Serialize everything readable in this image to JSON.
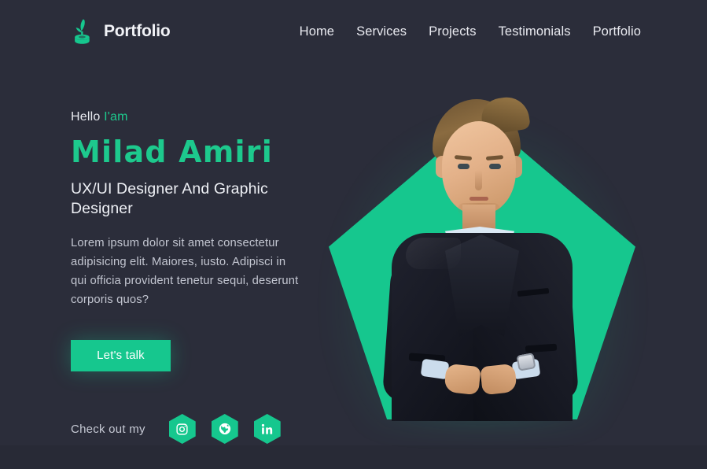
{
  "header": {
    "brand": {
      "name": "Portfolio",
      "logo_icon": "sprout-stamp-icon",
      "logo_color": "#16c78e"
    },
    "nav": [
      {
        "label": "Home"
      },
      {
        "label": "Services"
      },
      {
        "label": "Projects"
      },
      {
        "label": "Testimonials"
      },
      {
        "label": "Portfolio"
      }
    ]
  },
  "hero": {
    "greeting_prefix": "Hello ",
    "greeting_accent": "I'am",
    "name": "Milad Amiri",
    "role": "UX/UI Designer And Graphic Designer",
    "blurb": "Lorem ipsum dolor sit amet consectetur adipisicing elit. Maiores, iusto. Adipisci in qui officia provident tenetur sequi, deserunt corporis quos?",
    "cta_label": "Let's talk",
    "social_label": "Check out my",
    "socials": [
      {
        "name": "instagram",
        "icon": "instagram-icon"
      },
      {
        "name": "globe",
        "icon": "globe-icon"
      },
      {
        "name": "linkedin",
        "icon": "linkedin-icon"
      }
    ]
  },
  "theme": {
    "background": "#2b2d3a",
    "accent": "#16c78e",
    "accent_text": "#1dc98d",
    "text_primary": "#eef0f5",
    "text_muted": "#c3c6d1"
  }
}
